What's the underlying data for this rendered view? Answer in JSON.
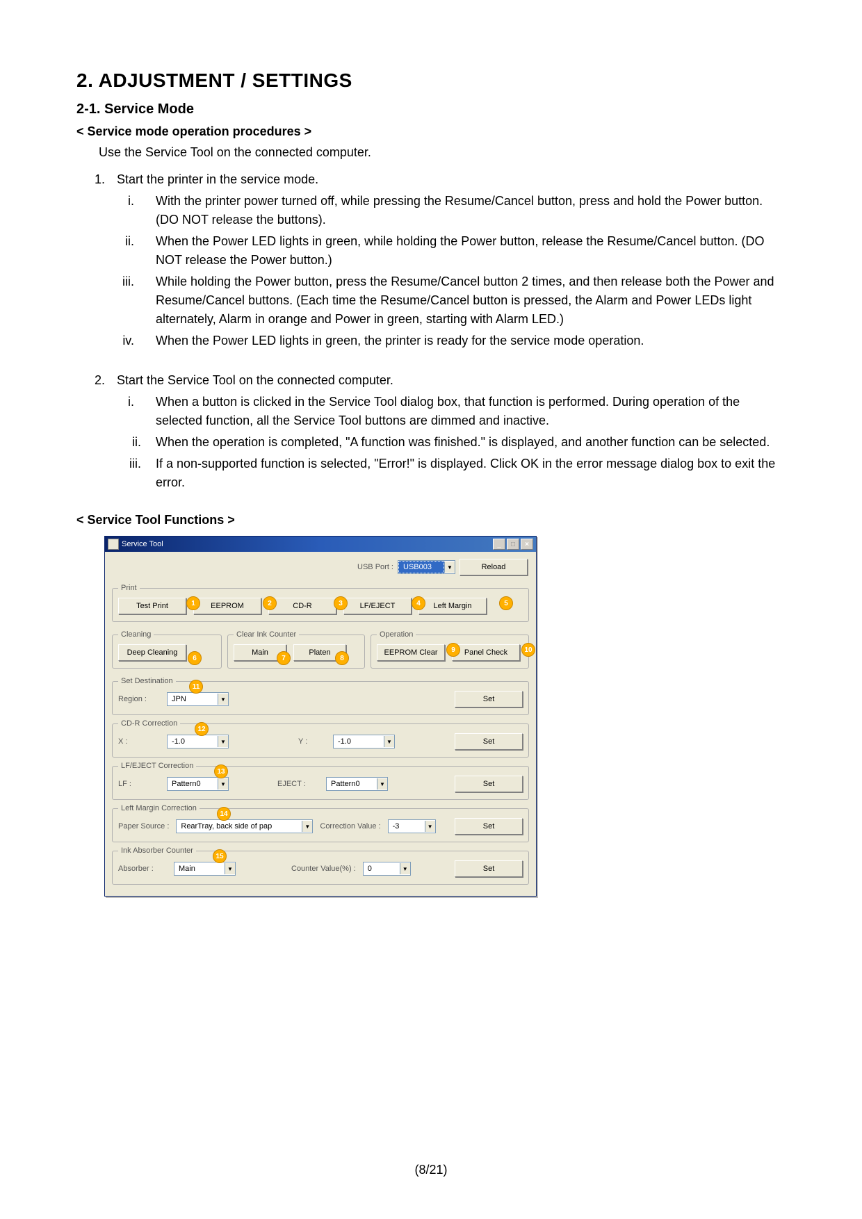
{
  "headings": {
    "h1": "2.   ADJUSTMENT / SETTINGS",
    "h2": "2-1.   Service Mode",
    "proc_heading": "< Service mode operation procedures >",
    "proc_intro": "Use the Service Tool on the connected computer.",
    "tool_heading": "< Service Tool Functions >"
  },
  "steps": {
    "s1_title": "Start the printer in the service mode.",
    "s1": [
      "With the printer power turned off, while pressing the Resume/Cancel button, press and hold the Power button. (DO NOT release the buttons).",
      "When the Power LED lights in green, while holding the Power button, release the Resume/Cancel button. (DO NOT release the Power button.)",
      "While holding the Power button, press the Resume/Cancel button 2 times, and then release both the Power and Resume/Cancel buttons. (Each time the Resume/Cancel button is pressed, the Alarm and Power LEDs light alternately, Alarm in orange and Power in green, starting with Alarm LED.)",
      "When the Power LED lights in green, the printer is ready for the service mode operation."
    ],
    "s2_title": "Start the Service Tool on the connected computer.",
    "s2": [
      "When a button is clicked in the Service Tool dialog box, that function is performed. During operation of the selected function, all the Service Tool buttons are dimmed and inactive.",
      "When the operation is completed, \"A function was finished.\" is displayed, and another function can be selected.",
      "If a non-supported function is selected, \"Error!\" is displayed. Click OK in the error message dialog box to exit the error."
    ]
  },
  "dlg": {
    "title": "Service Tool",
    "usb_label": "USB Port :",
    "usb_value": "USB003",
    "reload": "Reload",
    "groups": {
      "print": "Print",
      "cleaning": "Cleaning",
      "clear_ink": "Clear Ink Counter",
      "operation": "Operation",
      "set_dest": "Set Destination",
      "cdr": "CD-R Correction",
      "lfeject": "LF/EJECT Correction",
      "leftmargin": "Left Margin Correction",
      "ink_abs": "Ink Absorber Counter"
    },
    "btns": {
      "test_print": "Test Print",
      "eeprom": "EEPROM",
      "cdr": "CD-R",
      "lfeject": "LF/EJECT",
      "left_margin": "Left Margin",
      "deep_clean": "Deep Cleaning",
      "main": "Main",
      "platen": "Platen",
      "eeprom_clear": "EEPROM Clear",
      "panel_check": "Panel Check",
      "set": "Set"
    },
    "labels": {
      "region": "Region :",
      "x": "X :",
      "y": "Y :",
      "lf": "LF :",
      "eject": "EJECT :",
      "paper_source": "Paper Source :",
      "correction_value": "Correction Value :",
      "absorber": "Absorber :",
      "counter_value": "Counter Value(%) :"
    },
    "values": {
      "region": "JPN",
      "cdr_x": "-1.0",
      "cdr_y": "-1.0",
      "lf": "Pattern0",
      "eject": "Pattern0",
      "paper_source": "RearTray, back side of pap",
      "correction_value": "-3",
      "absorber": "Main",
      "counter_value": "0"
    },
    "badges": {
      "b1": "1",
      "b2": "2",
      "b3": "3",
      "b4": "4",
      "b5": "5",
      "b6": "6",
      "b7": "7",
      "b8": "8",
      "b9": "9",
      "b10": "10",
      "b11": "11",
      "b12": "12",
      "b13": "13",
      "b14": "14",
      "b15": "15"
    }
  },
  "page_number": "(8/21)"
}
